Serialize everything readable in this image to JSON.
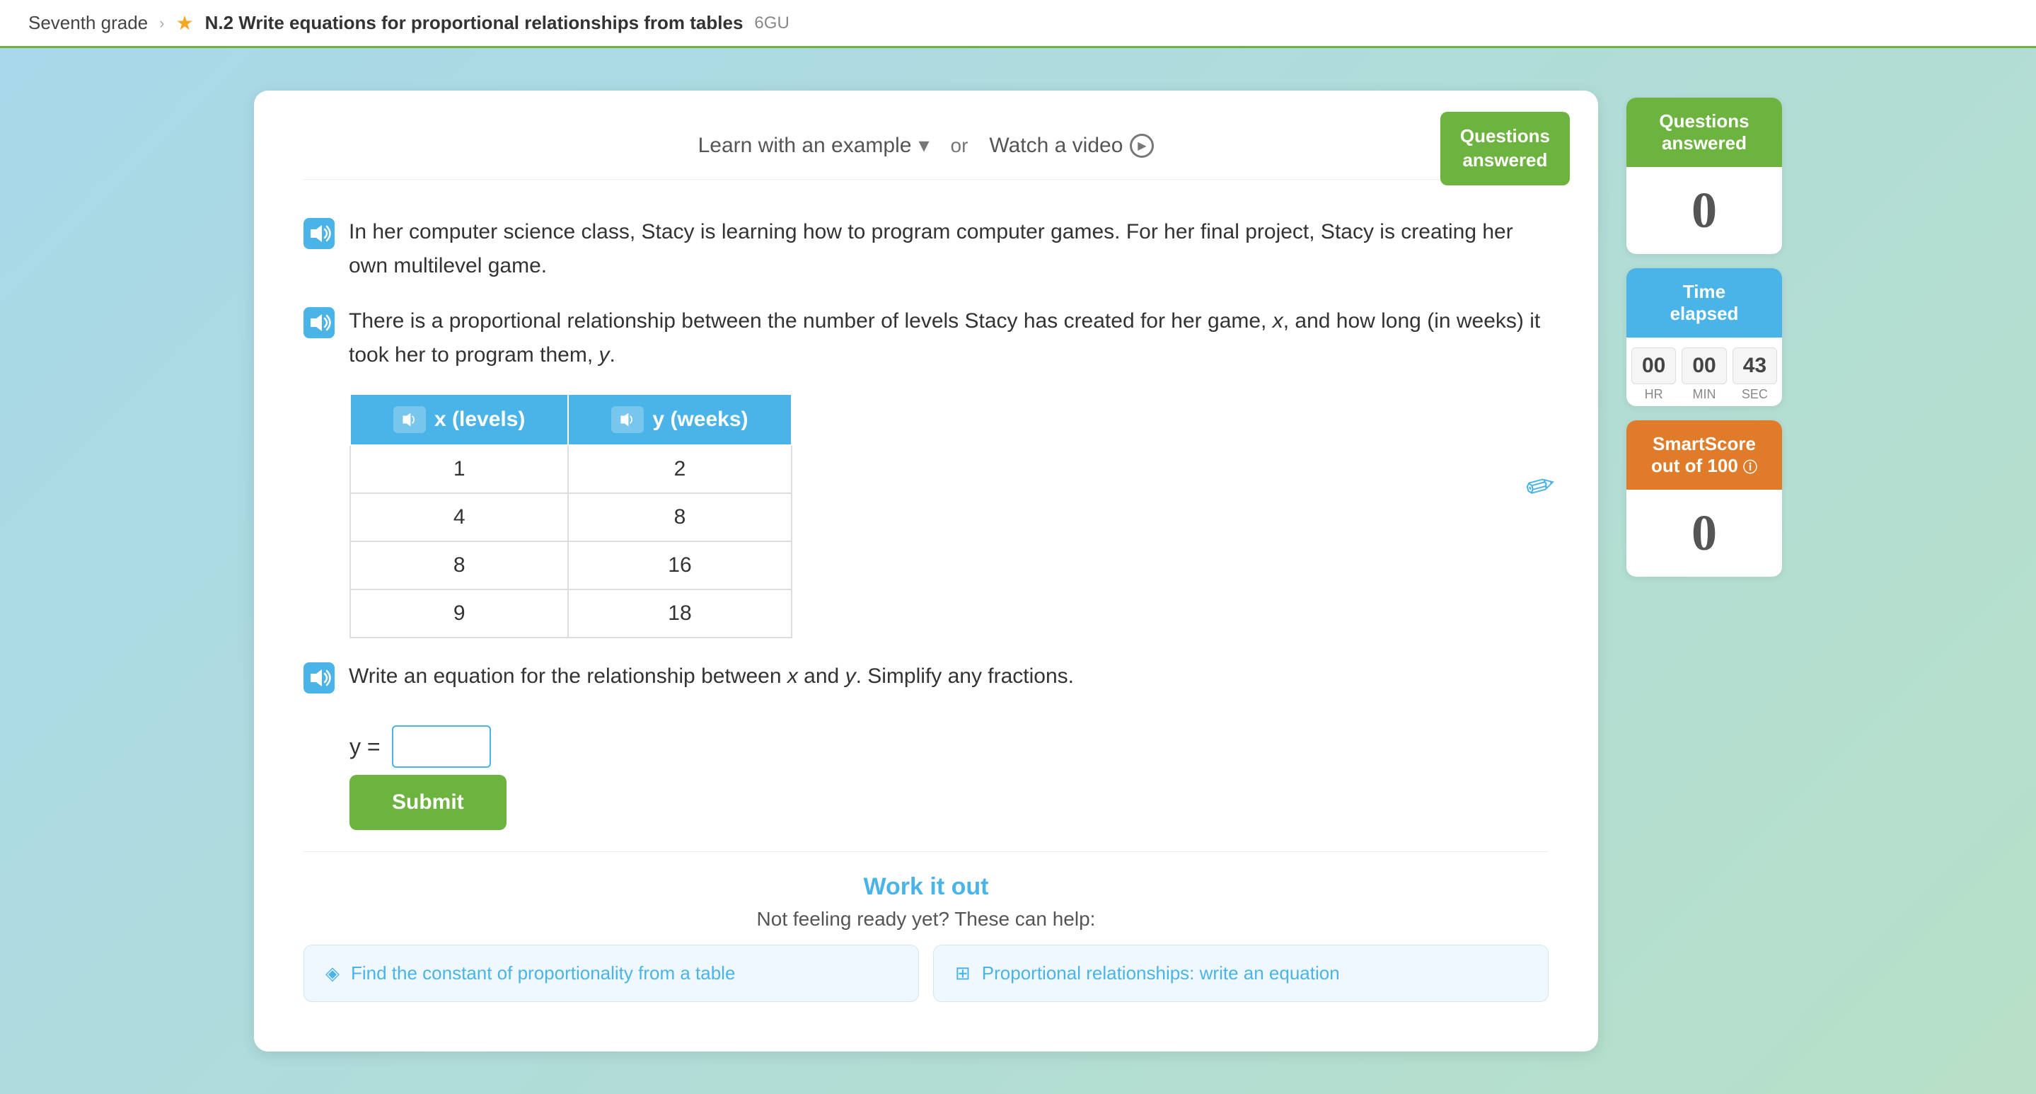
{
  "topbar": {
    "grade": "Seventh grade",
    "chevron": "›",
    "star": "★",
    "skill": "N.2 Write equations for proportional relationships from tables",
    "code": "6GU"
  },
  "header": {
    "learn_example": "Learn with an example",
    "or": "or",
    "watch_video": "Watch a video"
  },
  "questions_answered": {
    "line1": "Questions",
    "line2": "answered"
  },
  "questions_count": "0",
  "timer": {
    "hr": "00",
    "min": "00",
    "sec": "43",
    "hr_label": "HR",
    "min_label": "MIN",
    "sec_label": "SEC"
  },
  "smart_score": {
    "line1": "SmartScore",
    "line2": "out of 100"
  },
  "smart_score_value": "0",
  "problem": {
    "para1": "In her computer science class, Stacy is learning how to program computer games. For her final project, Stacy is creating her own multilevel game.",
    "para2": "There is a proportional relationship between the number of levels Stacy has created for her game, x, and how long (in weeks) it took her to program them, y.",
    "table": {
      "col1_header": "x (levels)",
      "col2_header": "y (weeks)",
      "rows": [
        {
          "x": "1",
          "y": "2"
        },
        {
          "x": "4",
          "y": "8"
        },
        {
          "x": "8",
          "y": "16"
        },
        {
          "x": "9",
          "y": "18"
        }
      ]
    },
    "question": "Write an equation for the relationship between x and y. Simplify any fractions.",
    "equation_prefix": "y =",
    "input_placeholder": "",
    "submit_label": "Submit"
  },
  "work_it_out": {
    "title": "Work it out",
    "subtitle": "Not feeling ready yet? These can help:",
    "card1": "Find the constant of proportionality from a table",
    "card2": "Proportional relationships: write an equation"
  }
}
